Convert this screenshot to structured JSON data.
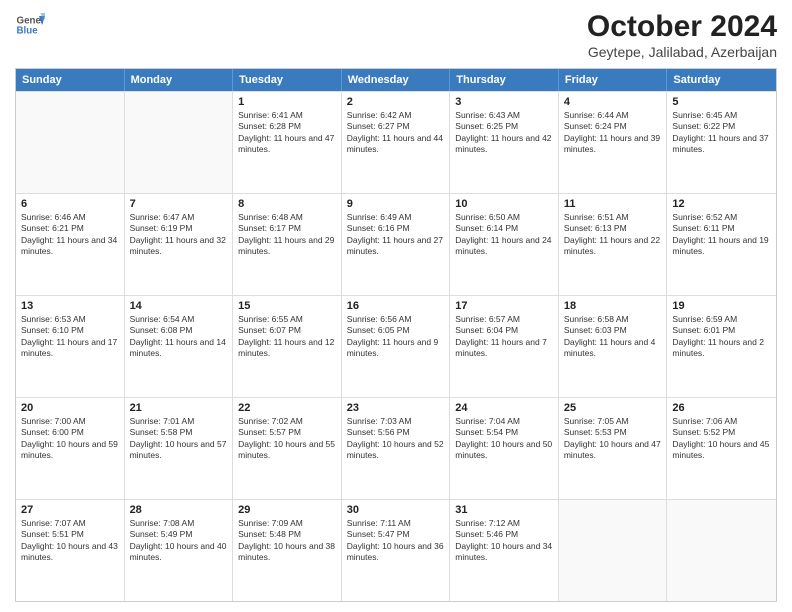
{
  "logo": {
    "line1": "General",
    "line2": "Blue"
  },
  "title": "October 2024",
  "subtitle": "Geytepe, Jalilabad, Azerbaijan",
  "days_of_week": [
    "Sunday",
    "Monday",
    "Tuesday",
    "Wednesday",
    "Thursday",
    "Friday",
    "Saturday"
  ],
  "weeks": [
    [
      {
        "day": "",
        "sunrise": "",
        "sunset": "",
        "daylight": "",
        "empty": true
      },
      {
        "day": "",
        "sunrise": "",
        "sunset": "",
        "daylight": "",
        "empty": true
      },
      {
        "day": "1",
        "sunrise": "Sunrise: 6:41 AM",
        "sunset": "Sunset: 6:28 PM",
        "daylight": "Daylight: 11 hours and 47 minutes."
      },
      {
        "day": "2",
        "sunrise": "Sunrise: 6:42 AM",
        "sunset": "Sunset: 6:27 PM",
        "daylight": "Daylight: 11 hours and 44 minutes."
      },
      {
        "day": "3",
        "sunrise": "Sunrise: 6:43 AM",
        "sunset": "Sunset: 6:25 PM",
        "daylight": "Daylight: 11 hours and 42 minutes."
      },
      {
        "day": "4",
        "sunrise": "Sunrise: 6:44 AM",
        "sunset": "Sunset: 6:24 PM",
        "daylight": "Daylight: 11 hours and 39 minutes."
      },
      {
        "day": "5",
        "sunrise": "Sunrise: 6:45 AM",
        "sunset": "Sunset: 6:22 PM",
        "daylight": "Daylight: 11 hours and 37 minutes."
      }
    ],
    [
      {
        "day": "6",
        "sunrise": "Sunrise: 6:46 AM",
        "sunset": "Sunset: 6:21 PM",
        "daylight": "Daylight: 11 hours and 34 minutes."
      },
      {
        "day": "7",
        "sunrise": "Sunrise: 6:47 AM",
        "sunset": "Sunset: 6:19 PM",
        "daylight": "Daylight: 11 hours and 32 minutes."
      },
      {
        "day": "8",
        "sunrise": "Sunrise: 6:48 AM",
        "sunset": "Sunset: 6:17 PM",
        "daylight": "Daylight: 11 hours and 29 minutes."
      },
      {
        "day": "9",
        "sunrise": "Sunrise: 6:49 AM",
        "sunset": "Sunset: 6:16 PM",
        "daylight": "Daylight: 11 hours and 27 minutes."
      },
      {
        "day": "10",
        "sunrise": "Sunrise: 6:50 AM",
        "sunset": "Sunset: 6:14 PM",
        "daylight": "Daylight: 11 hours and 24 minutes."
      },
      {
        "day": "11",
        "sunrise": "Sunrise: 6:51 AM",
        "sunset": "Sunset: 6:13 PM",
        "daylight": "Daylight: 11 hours and 22 minutes."
      },
      {
        "day": "12",
        "sunrise": "Sunrise: 6:52 AM",
        "sunset": "Sunset: 6:11 PM",
        "daylight": "Daylight: 11 hours and 19 minutes."
      }
    ],
    [
      {
        "day": "13",
        "sunrise": "Sunrise: 6:53 AM",
        "sunset": "Sunset: 6:10 PM",
        "daylight": "Daylight: 11 hours and 17 minutes."
      },
      {
        "day": "14",
        "sunrise": "Sunrise: 6:54 AM",
        "sunset": "Sunset: 6:08 PM",
        "daylight": "Daylight: 11 hours and 14 minutes."
      },
      {
        "day": "15",
        "sunrise": "Sunrise: 6:55 AM",
        "sunset": "Sunset: 6:07 PM",
        "daylight": "Daylight: 11 hours and 12 minutes."
      },
      {
        "day": "16",
        "sunrise": "Sunrise: 6:56 AM",
        "sunset": "Sunset: 6:05 PM",
        "daylight": "Daylight: 11 hours and 9 minutes."
      },
      {
        "day": "17",
        "sunrise": "Sunrise: 6:57 AM",
        "sunset": "Sunset: 6:04 PM",
        "daylight": "Daylight: 11 hours and 7 minutes."
      },
      {
        "day": "18",
        "sunrise": "Sunrise: 6:58 AM",
        "sunset": "Sunset: 6:03 PM",
        "daylight": "Daylight: 11 hours and 4 minutes."
      },
      {
        "day": "19",
        "sunrise": "Sunrise: 6:59 AM",
        "sunset": "Sunset: 6:01 PM",
        "daylight": "Daylight: 11 hours and 2 minutes."
      }
    ],
    [
      {
        "day": "20",
        "sunrise": "Sunrise: 7:00 AM",
        "sunset": "Sunset: 6:00 PM",
        "daylight": "Daylight: 10 hours and 59 minutes."
      },
      {
        "day": "21",
        "sunrise": "Sunrise: 7:01 AM",
        "sunset": "Sunset: 5:58 PM",
        "daylight": "Daylight: 10 hours and 57 minutes."
      },
      {
        "day": "22",
        "sunrise": "Sunrise: 7:02 AM",
        "sunset": "Sunset: 5:57 PM",
        "daylight": "Daylight: 10 hours and 55 minutes."
      },
      {
        "day": "23",
        "sunrise": "Sunrise: 7:03 AM",
        "sunset": "Sunset: 5:56 PM",
        "daylight": "Daylight: 10 hours and 52 minutes."
      },
      {
        "day": "24",
        "sunrise": "Sunrise: 7:04 AM",
        "sunset": "Sunset: 5:54 PM",
        "daylight": "Daylight: 10 hours and 50 minutes."
      },
      {
        "day": "25",
        "sunrise": "Sunrise: 7:05 AM",
        "sunset": "Sunset: 5:53 PM",
        "daylight": "Daylight: 10 hours and 47 minutes."
      },
      {
        "day": "26",
        "sunrise": "Sunrise: 7:06 AM",
        "sunset": "Sunset: 5:52 PM",
        "daylight": "Daylight: 10 hours and 45 minutes."
      }
    ],
    [
      {
        "day": "27",
        "sunrise": "Sunrise: 7:07 AM",
        "sunset": "Sunset: 5:51 PM",
        "daylight": "Daylight: 10 hours and 43 minutes."
      },
      {
        "day": "28",
        "sunrise": "Sunrise: 7:08 AM",
        "sunset": "Sunset: 5:49 PM",
        "daylight": "Daylight: 10 hours and 40 minutes."
      },
      {
        "day": "29",
        "sunrise": "Sunrise: 7:09 AM",
        "sunset": "Sunset: 5:48 PM",
        "daylight": "Daylight: 10 hours and 38 minutes."
      },
      {
        "day": "30",
        "sunrise": "Sunrise: 7:11 AM",
        "sunset": "Sunset: 5:47 PM",
        "daylight": "Daylight: 10 hours and 36 minutes."
      },
      {
        "day": "31",
        "sunrise": "Sunrise: 7:12 AM",
        "sunset": "Sunset: 5:46 PM",
        "daylight": "Daylight: 10 hours and 34 minutes."
      },
      {
        "day": "",
        "sunrise": "",
        "sunset": "",
        "daylight": "",
        "empty": true
      },
      {
        "day": "",
        "sunrise": "",
        "sunset": "",
        "daylight": "",
        "empty": true
      }
    ]
  ]
}
